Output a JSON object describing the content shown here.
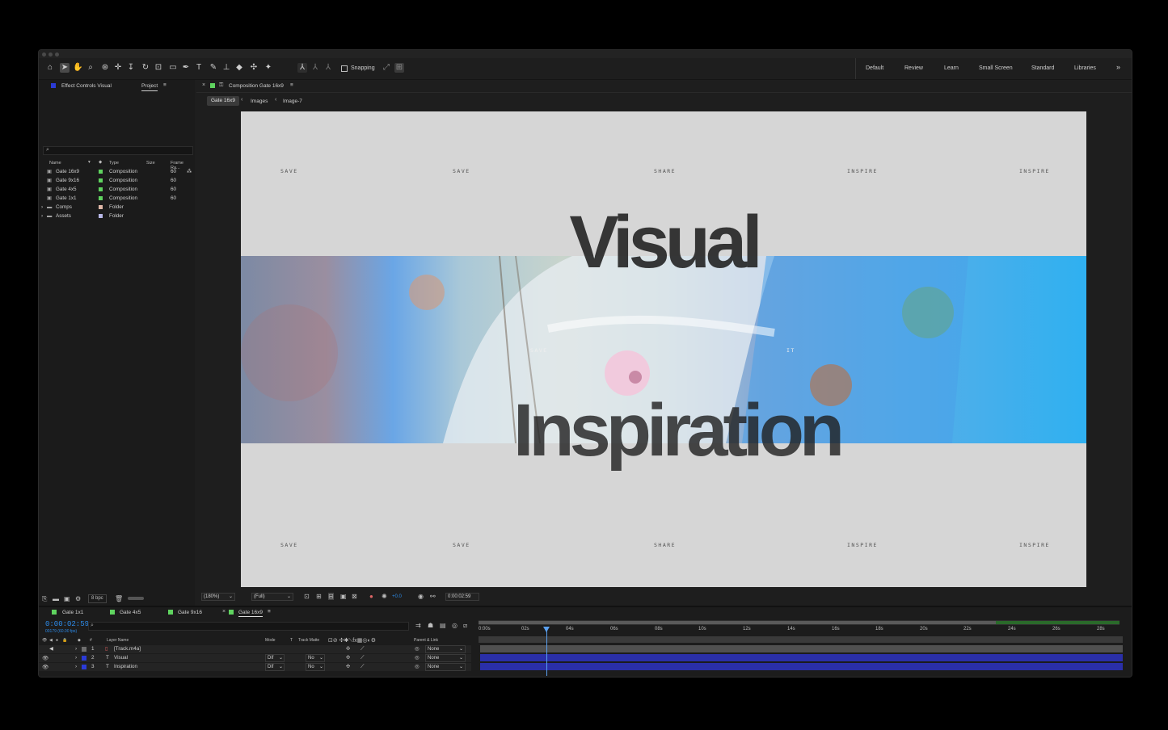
{
  "toolbar": {
    "snapping_label": "Snapping",
    "workspaces": [
      "Default",
      "Review",
      "Learn",
      "Small Screen",
      "Standard",
      "Libraries"
    ],
    "more": "»"
  },
  "left_panel": {
    "tabs": [
      "Effect Controls Visual",
      "Project"
    ],
    "columns": [
      "Name",
      "Type",
      "Size",
      "Frame Ra..."
    ],
    "items": [
      {
        "name": "Gate 16x9",
        "type": "Composition",
        "rate": "60",
        "color": "#5fd35f"
      },
      {
        "name": "Gate 9x16",
        "type": "Composition",
        "rate": "60",
        "color": "#5fd35f"
      },
      {
        "name": "Gate 4x5",
        "type": "Composition",
        "rate": "60",
        "color": "#5fd35f"
      },
      {
        "name": "Gate 1x1",
        "type": "Composition",
        "rate": "60",
        "color": "#5fd35f"
      },
      {
        "name": "Comps",
        "type": "Folder",
        "rate": "",
        "color": "#e0b8a8"
      },
      {
        "name": "Assets",
        "type": "Folder",
        "rate": "",
        "color": "#b8b8e8"
      }
    ],
    "bpc": "8 bpc"
  },
  "comp_panel": {
    "title": "Composition Gate 16x9",
    "breadcrumbs": [
      "Gate 16x9",
      "Images",
      "Image-7"
    ],
    "zoom": "(180%)",
    "resolution": "(Full)",
    "exposure": "+0.0",
    "timecode": "0:00:02:59"
  },
  "artwork": {
    "row_top": [
      "SAVE",
      "SAVE",
      "SHARE",
      "INSPIRE",
      "INSPIRE"
    ],
    "row_bottom": [
      "SAVE",
      "SAVE",
      "SHARE",
      "INSPIRE",
      "INSPIRE"
    ],
    "headline_top": "Visual",
    "headline_bottom": "Inspiration",
    "mid_left": "SAVE",
    "mid_right": "IT"
  },
  "timeline": {
    "tabs": [
      "Gate 1x1",
      "Gate 4x5",
      "Gate 9x16",
      "Gate 16x9"
    ],
    "timecode": "0:00:02:59",
    "frame_info": "00179 (60.00 fps)",
    "columns": [
      "#",
      "Layer Name",
      "Mode",
      "T",
      "Track Matte",
      "Parent & Link"
    ],
    "layers": [
      {
        "num": "1",
        "name": "[Track.m4a]",
        "mode": "",
        "matte": "",
        "parent": "None",
        "color": "#6e6e6e"
      },
      {
        "num": "2",
        "name": "Visual",
        "mode": "Dif",
        "matte": "No",
        "parent": "None",
        "color": "#2b3bd6"
      },
      {
        "num": "3",
        "name": "Inspiration",
        "mode": "Dif",
        "matte": "No",
        "parent": "None",
        "color": "#2b3bd6"
      }
    ],
    "ticks": [
      "0:00s",
      "02s",
      "04s",
      "06s",
      "08s",
      "10s",
      "12s",
      "14s",
      "16s",
      "18s",
      "20s",
      "22s",
      "24s",
      "26s",
      "28s"
    ]
  },
  "colors": {
    "accent": "#2d8ceb",
    "layer_bar": "#2a2fa8",
    "audio_bar": "#505050",
    "label_green": "#5fd35f"
  }
}
